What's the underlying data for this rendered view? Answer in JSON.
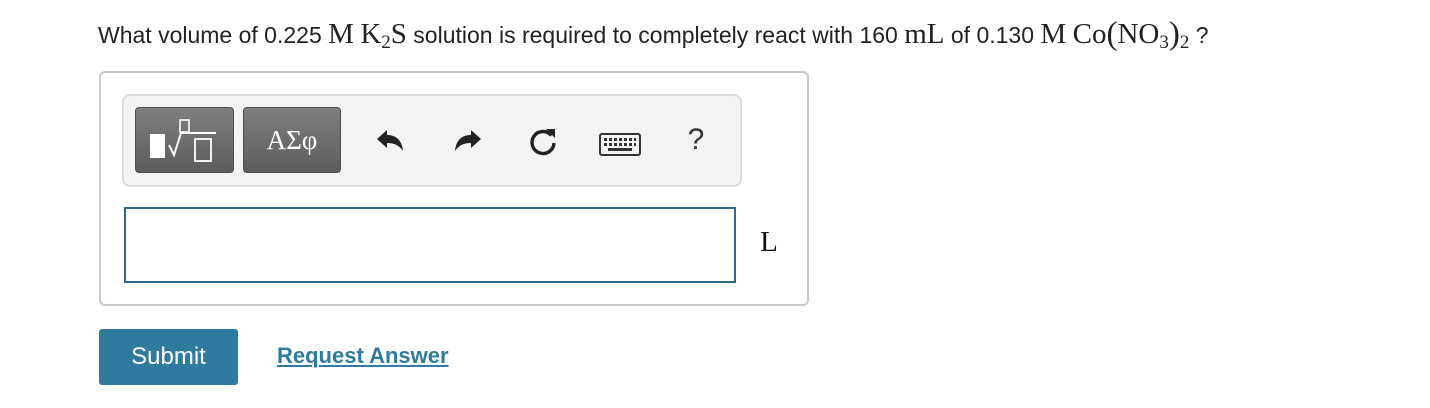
{
  "question": {
    "t1": "What volume of 0.225 ",
    "m1": "M",
    "k": "K",
    "k_sub": "2",
    "s": "S",
    "t2": " solution is required to completely react with 160 ",
    "ml": "mL",
    "t3": " of 0.130 ",
    "m2": "M",
    "co": "Co",
    "paren_open": "(",
    "no": "NO",
    "no_sub": "3",
    "paren_close": ")",
    "outer_sub": "2",
    "t4": " ?"
  },
  "toolbar": {
    "symbols_label": "ΑΣφ",
    "help_label": "?",
    "icons": [
      "templates-icon",
      "undo-icon",
      "redo-icon",
      "reset-icon",
      "keyboard-icon",
      "help-icon"
    ]
  },
  "answer": {
    "value": "",
    "unit": "L"
  },
  "actions": {
    "submit_label": "Submit",
    "request_label": "Request Answer"
  },
  "colors": {
    "primary": "#2f7ba0",
    "input_border": "#2c6b88",
    "toolbar_button": "#6b6b6b",
    "panel_border": "#c8c8c8"
  }
}
